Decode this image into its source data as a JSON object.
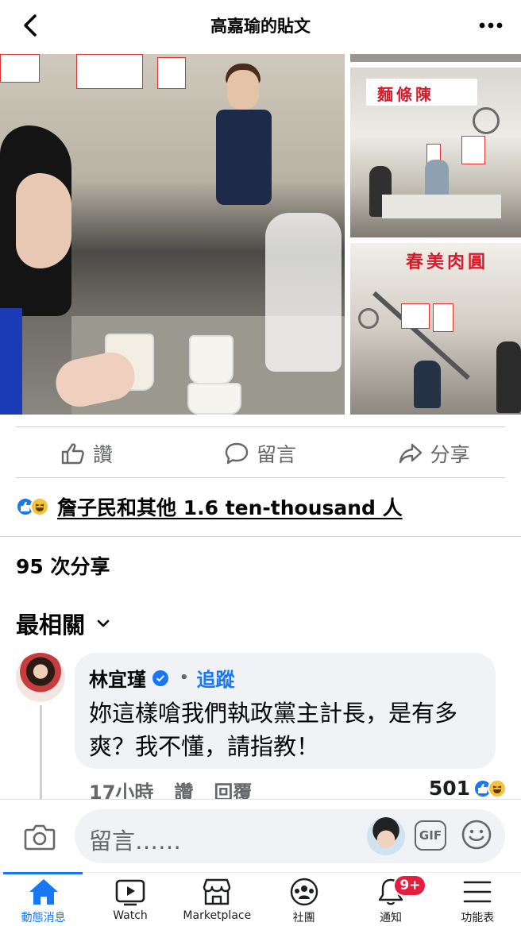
{
  "header": {
    "title": "高嘉瑜的貼文",
    "back_icon": "chevron-left-icon",
    "more_icon": "more-horizontal-icon"
  },
  "photos": {
    "shop_sign_1": "麵條陳",
    "shop_sign_2": "春美肉圓"
  },
  "actions": {
    "like": "讚",
    "comment": "留言",
    "share": "分享"
  },
  "reactions": {
    "text": "詹子民和其他 1.6 ten-thousand 人"
  },
  "shares": {
    "text": "95 次分享"
  },
  "sort": {
    "label": "最相關"
  },
  "comment": {
    "author": "林宜瑾",
    "follow_label": "追蹤",
    "text": "妳這樣嗆我們執政黨主計長，是有多爽？我不懂，請指教！",
    "time": "17小時",
    "like_label": "讚",
    "reply_label": "回覆",
    "reaction_count": "501"
  },
  "composer": {
    "placeholder": "留言……",
    "gif_label": "GIF"
  },
  "tabs": [
    {
      "label": "動態消息",
      "icon": "home-icon",
      "active": true
    },
    {
      "label": "Watch",
      "icon": "video-icon"
    },
    {
      "label": "Marketplace",
      "icon": "shop-icon"
    },
    {
      "label": "社團",
      "icon": "groups-icon"
    },
    {
      "label": "通知",
      "icon": "bell-icon",
      "badge": "9+"
    },
    {
      "label": "功能表",
      "icon": "menu-icon"
    }
  ],
  "colors": {
    "brand_blue": "#1877f2",
    "text_secondary": "#65676b",
    "badge_red": "#e41e3f"
  }
}
